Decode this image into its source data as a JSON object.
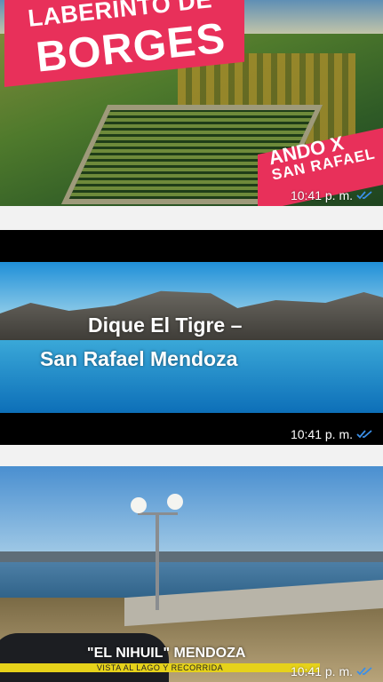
{
  "messages": [
    {
      "banner_line1": "LABERINTO DE",
      "banner_line2": "BORGES",
      "corner_line1": "ANDO X",
      "corner_line2": "SAN RAFAEL",
      "time": "10:41 p. m."
    },
    {
      "caption_line1": "Dique El Tigre –",
      "caption_line2": "San Rafael Mendoza",
      "time": "10:41 p. m."
    },
    {
      "caption_main": "\"EL NIHUIL\" MENDOZA",
      "caption_sub": "VISTA AL LAGO Y RECORRIDA",
      "time": "10:41 p. m."
    }
  ],
  "icons": {
    "read_receipt": "double-check-icon"
  },
  "colors": {
    "banner_pink": "#e8305a",
    "tick_blue": "#3b8fe8",
    "caption_yellow": "#e6d21a"
  }
}
